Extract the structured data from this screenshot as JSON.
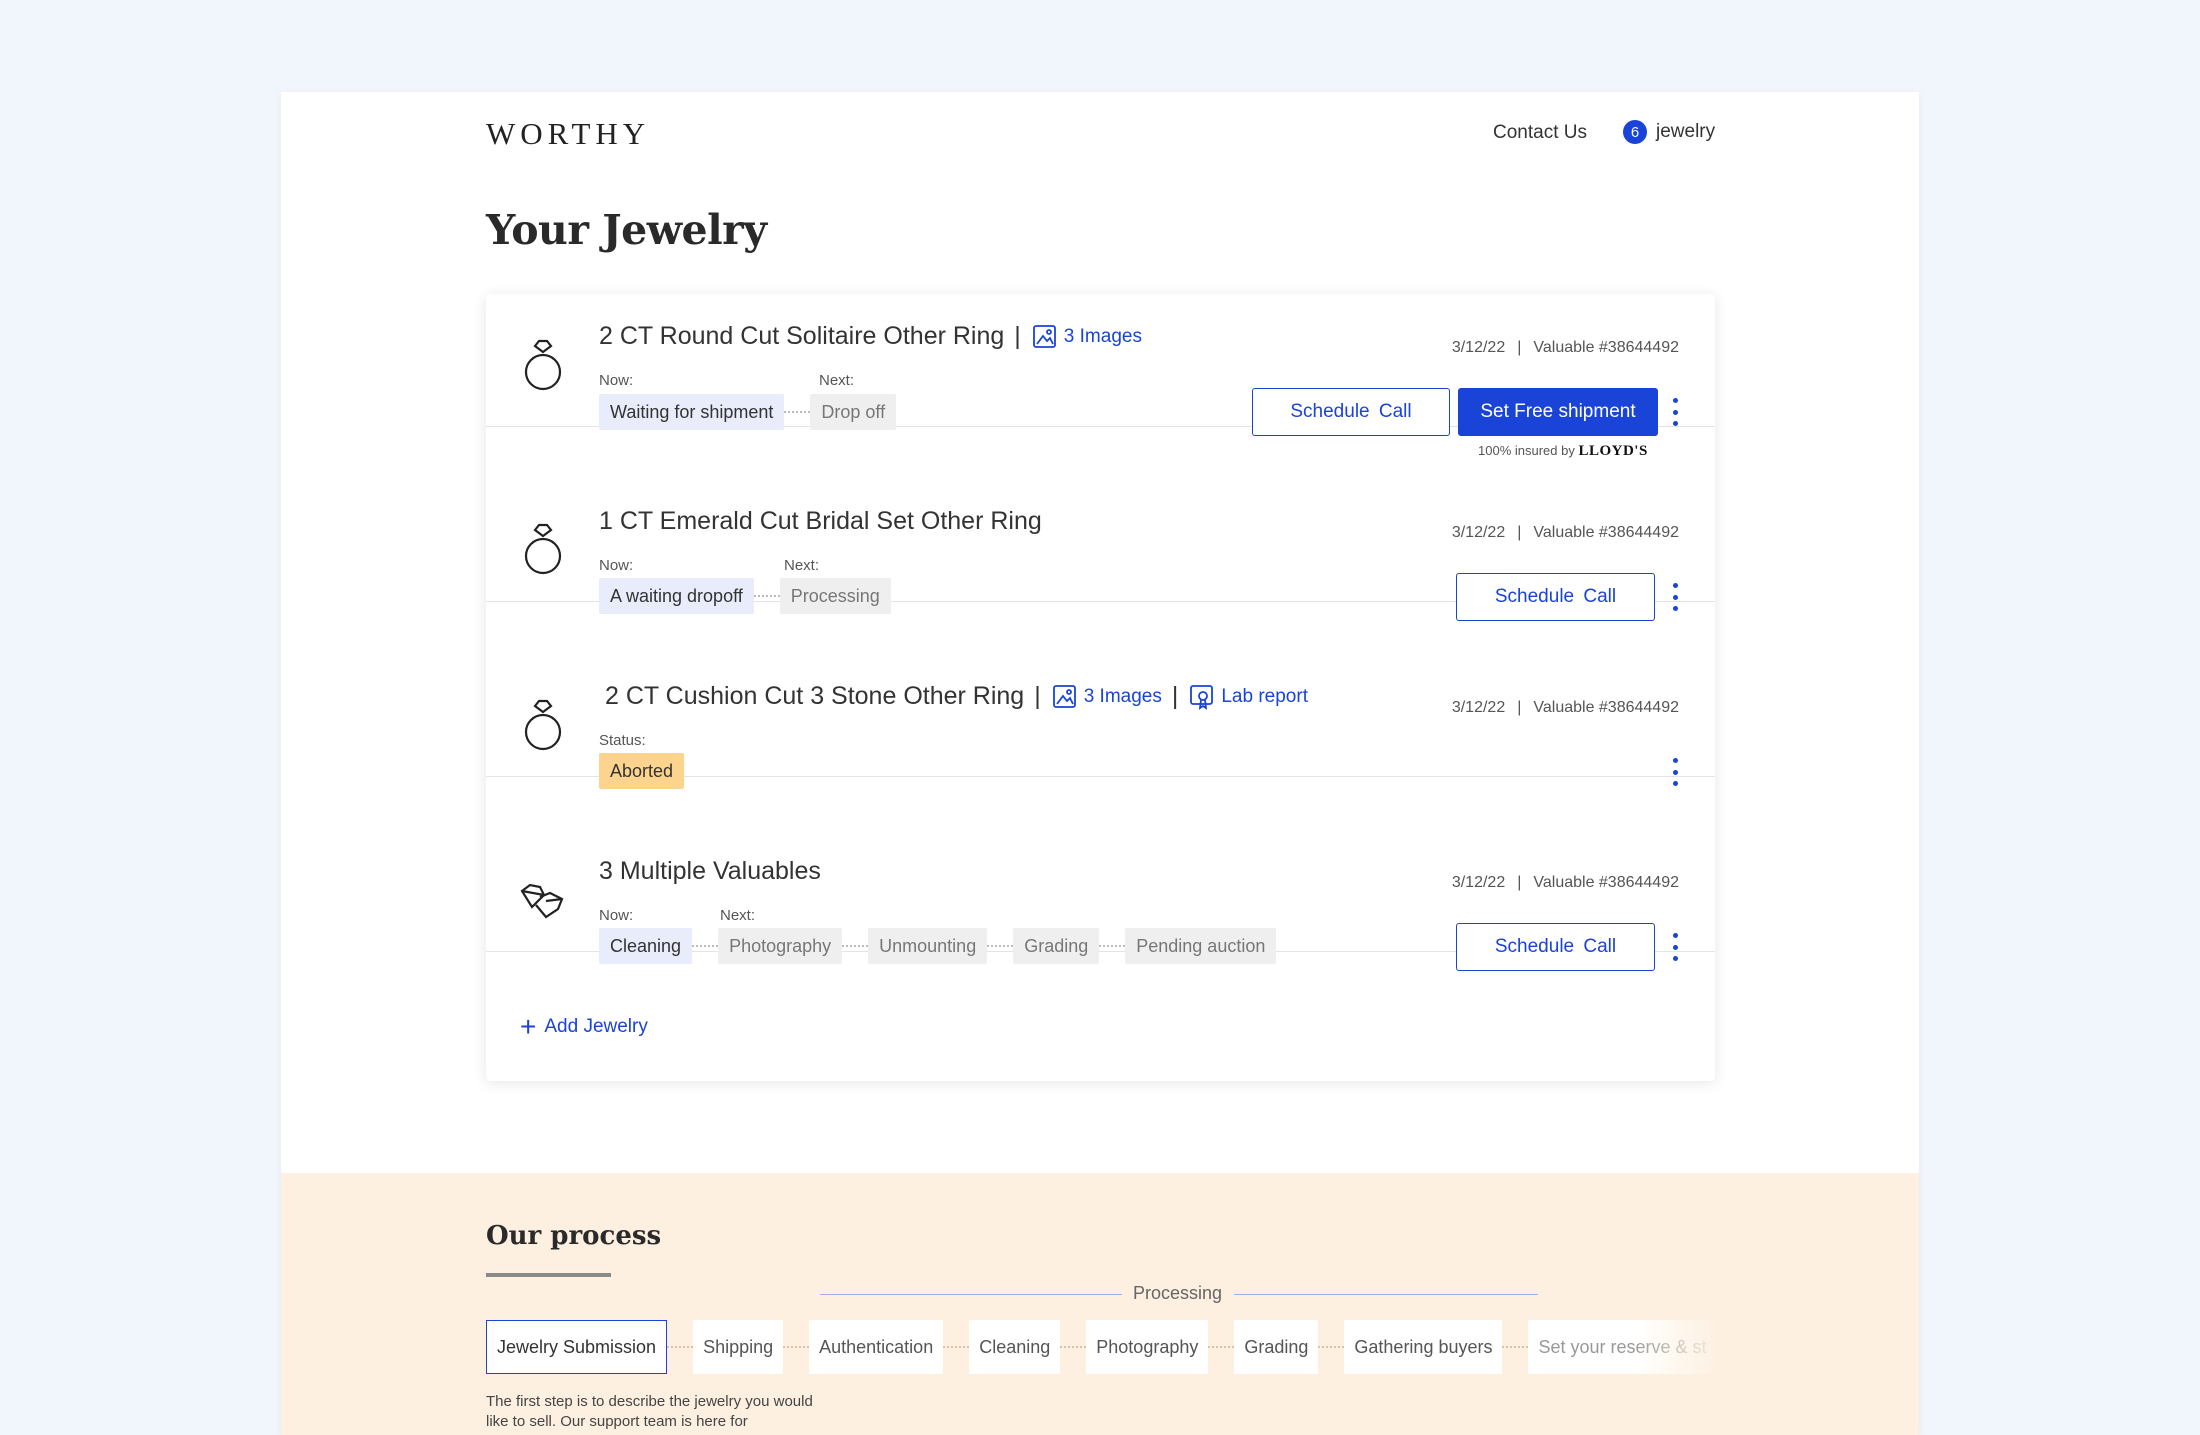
{
  "header": {
    "logo": "WORTHY",
    "contact": "Contact Us",
    "jewelry_count": "6",
    "jewelry_label": "jewelry"
  },
  "page_title": "Your Jewelry",
  "items": [
    {
      "title": "2 CT Round Cut Solitaire Other Ring",
      "images": "3 Images",
      "date": "3/12/22",
      "valuable": "Valuable #38644492",
      "now_label": "Now:",
      "next_label": "Next:",
      "now": "Waiting for shipment",
      "next": "Drop off",
      "schedule": "Schedule Call",
      "shipment": "Set Free shipment",
      "insured_text": "100% insured by",
      "insured_brand": "LLOYD'S"
    },
    {
      "title": "1 CT Emerald Cut Bridal Set Other Ring",
      "date": "3/12/22",
      "valuable": "Valuable #38644492",
      "now_label": "Now:",
      "next_label": "Next:",
      "now": "A waiting dropoff",
      "next": "Processing",
      "schedule": "Schedule Call"
    },
    {
      "title": "2 CT Cushion Cut 3 Stone Other Ring",
      "images": "3 Images",
      "lab_report": "Lab report",
      "date": "3/12/22",
      "valuable": "Valuable #38644492",
      "status_label": "Status:",
      "status": "Aborted"
    },
    {
      "title": "3 Multiple Valuables",
      "date": "3/12/22",
      "valuable": "Valuable #38644492",
      "now_label": "Now:",
      "next_label": "Next:",
      "now": "Cleaning",
      "next_steps": [
        "Photography",
        "Unmounting",
        "Grading",
        "Pending auction"
      ],
      "schedule": "Schedule Call"
    }
  ],
  "add_jewelry": "Add Jewelry",
  "process": {
    "title": "Our process",
    "processing_label": "Processing",
    "steps": [
      "Jewelry Submission",
      "Shipping",
      "Authentication",
      "Cleaning",
      "Photography",
      "Grading",
      "Gathering buyers",
      "Set your reserve & st"
    ],
    "description": "The first step is to describe the jewelry you would like to sell. Our support team is here for"
  },
  "icons": {
    "ring": "ring-icon",
    "diamonds": "diamonds-icon",
    "images": "images-icon",
    "lab_report": "certificate-icon",
    "more": "kebab-menu-icon",
    "add": "plus-icon"
  },
  "colors": {
    "accent": "#1a43d8",
    "now_chip": "#e8ecfb",
    "next_chip": "#efefef",
    "aborted": "#fdd48d",
    "process_bg": "#fdf0e0",
    "page_bg": "#f1f5fc"
  }
}
